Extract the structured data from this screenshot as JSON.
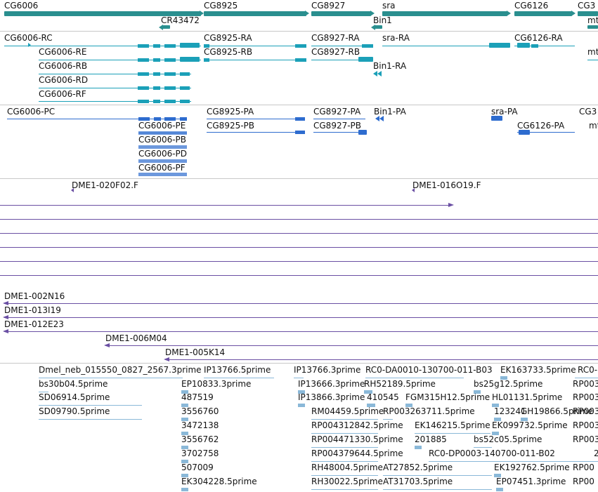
{
  "colors": {
    "gene": "#2a8f8f",
    "flybase_transcript": "#1ba0b8",
    "refseq_transcript": "#2e6ccf",
    "clone": "#6a4fa3",
    "est": "#8ab8d8",
    "separator": "#c8c8c8"
  },
  "genes": [
    {
      "name": "CG6006",
      "strand": "+"
    },
    {
      "name": "CG8925",
      "strand": "+"
    },
    {
      "name": "CG8927",
      "strand": "+"
    },
    {
      "name": "sra",
      "strand": "+"
    },
    {
      "name": "CG6126",
      "strand": "+"
    },
    {
      "name": "CG3",
      "strand": "+"
    },
    {
      "name": "CR43472",
      "strand": "-"
    },
    {
      "name": "Bin1",
      "strand": "-"
    },
    {
      "name": "mt",
      "strand": "+"
    }
  ],
  "flybase_transcripts": [
    "CG6006-RC",
    "CG6006-RE",
    "CG6006-RB",
    "CG6006-RD",
    "CG6006-RF",
    "CG8925-RA",
    "CG8925-RB",
    "CG8927-RA",
    "CG8927-RB",
    "sra-RA",
    "Bin1-RA",
    "CG6126-RA",
    "mt"
  ],
  "refseq_transcripts": [
    "CG6006-PC",
    "CG6006-PE",
    "CG6006-PB",
    "CG6006-PD",
    "CG6006-PF",
    "CG8925-PA",
    "CG8925-PB",
    "CG8927-PA",
    "CG8927-PB",
    "Bin1-PA",
    "sra-PA",
    "CG6126-PA",
    "CG3",
    "mt"
  ],
  "clones": [
    "DME1-020F02.F",
    "DME1-016O19.F",
    "DME1-002N16",
    "DME1-013I19",
    "DME1-012E23",
    "DME1-006M04",
    "DME1-005K14"
  ],
  "ests": [
    "Dmel_neb_015550_0827_2567.3prime",
    "bs30b04.5prime",
    "SD06914.5prime",
    "SD09790.5prime",
    "IP13766.5prime",
    "EP10833.3prime",
    "487519",
    "3556760",
    "3472138",
    "3556762",
    "3702758",
    "507009",
    "EK304228.5prime",
    "IP13766.3prime",
    "IP13666.3prime",
    "IP13866.3prime",
    "RC0-DA0010-130700-011-B03",
    "RH52189.5prime",
    "410545",
    "RM04459.5prime",
    "RP003263711.5prime",
    "RP004312842.5prime",
    "RP004471330.5prime",
    "RP004379644.5prime",
    "RH48004.5prime",
    "RH30022.5prime",
    "FGM315H12.5prime",
    "EK146215.5prime",
    "201885",
    "AT27852.5prime",
    "AT31703.5prime",
    "bs25g12.5prime",
    "HL01131.5prime",
    "123241",
    "GH19866.5prime",
    "EK099732.5prime",
    "bs52c05.5prime",
    "RC0-DP0003-140700-011-B02",
    "EK192762.5prime",
    "EP07451.3prime",
    "EK163733.5prime",
    "RC0-",
    "RP003",
    "RP00",
    "2"
  ]
}
